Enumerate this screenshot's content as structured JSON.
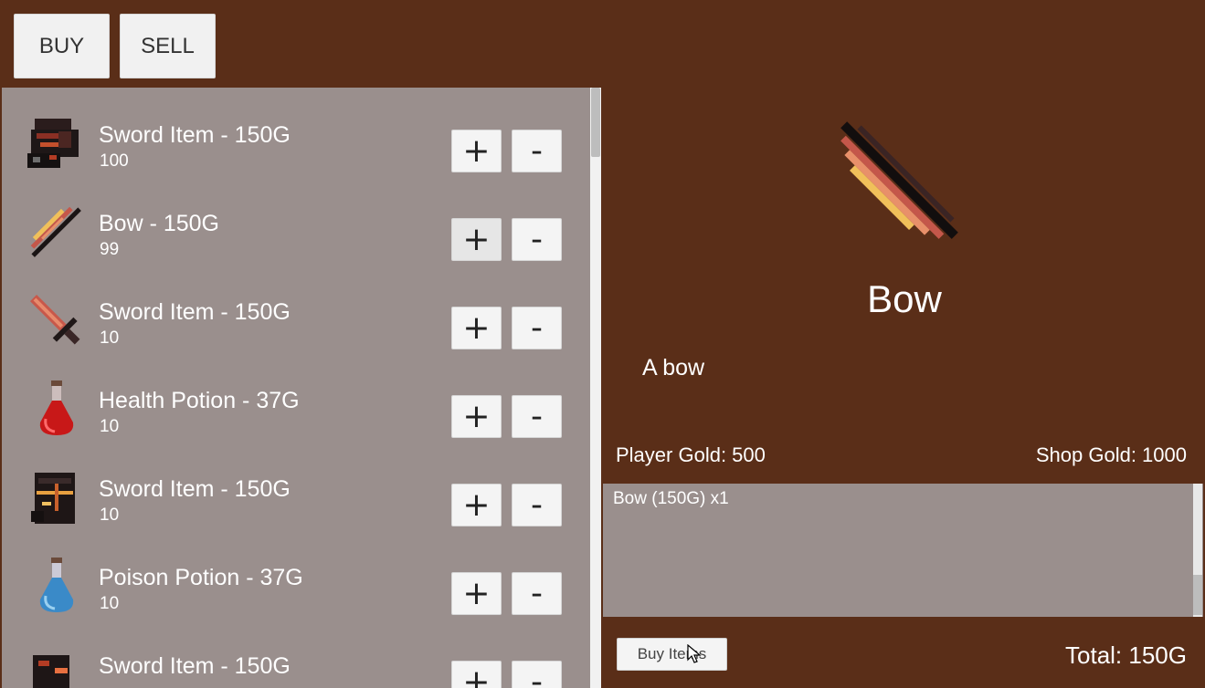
{
  "tabs": {
    "buy_label": "BUY",
    "sell_label": "SELL"
  },
  "items": [
    {
      "name": "Sword Item - 150G",
      "count": "100",
      "icon": "helmet-icon"
    },
    {
      "name": "Bow - 150G",
      "count": "99",
      "icon": "bow-icon"
    },
    {
      "name": "Sword Item - 150G",
      "count": "10",
      "icon": "sword-icon"
    },
    {
      "name": "Health Potion - 37G",
      "count": "10",
      "icon": "red-potion-icon"
    },
    {
      "name": "Sword Item - 150G",
      "count": "10",
      "icon": "armor-icon"
    },
    {
      "name": "Poison Potion - 37G",
      "count": "10",
      "icon": "blue-potion-icon"
    },
    {
      "name": "Sword Item - 150G",
      "count": "",
      "icon": "gauntlet-icon"
    }
  ],
  "buttons": {
    "plus": "+",
    "minus": "-"
  },
  "detail": {
    "name": "Bow",
    "description": "A bow",
    "icon": "bow-icon"
  },
  "gold": {
    "player": "Player Gold: 500",
    "shop": "Shop Gold: 1000"
  },
  "cart": {
    "lines": [
      "Bow (150G) x1"
    ]
  },
  "footer": {
    "buy_items_label": "Buy Items",
    "total": "Total: 150G"
  },
  "colors": {
    "background": "#5a2e18",
    "panel": "#9a8f8d",
    "button": "#f4f4f4"
  }
}
